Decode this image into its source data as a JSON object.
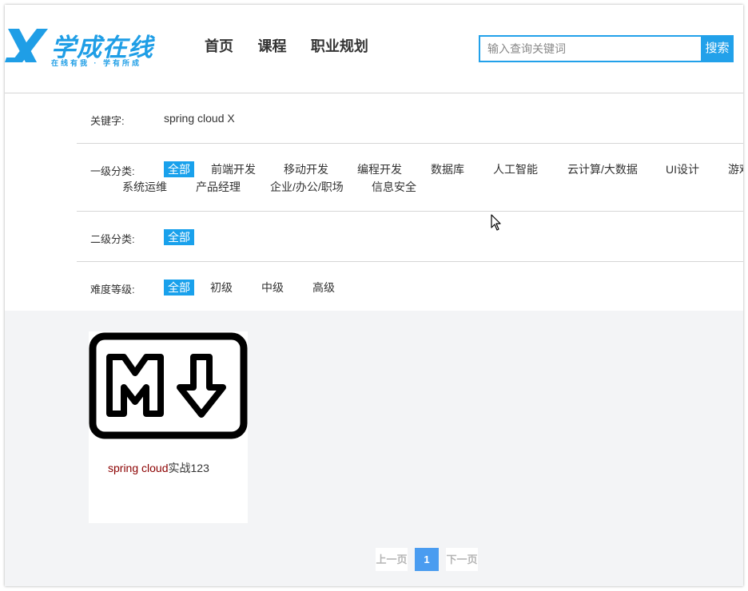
{
  "header": {
    "logo_title": "学成在线",
    "logo_slogan": "在线有我 · 学有所成",
    "nav": [
      {
        "label": "首页"
      },
      {
        "label": "课程"
      },
      {
        "label": "职业规划"
      }
    ],
    "search": {
      "value": "",
      "placeholder": "输入查询关键词",
      "button_label": "搜索"
    }
  },
  "filter": {
    "keyword_label": "关键字:",
    "keyword_value": "spring cloud",
    "keyword_clear": "X",
    "level1_label": "一级分类:",
    "level1_options": [
      "全部",
      "前端开发",
      "移动开发",
      "编程开发",
      "数据库",
      "人工智能",
      "云计算/大数据",
      "UI设计",
      "游戏",
      "系统运维",
      "产品经理",
      "企业/办公/职场",
      "信息安全"
    ],
    "level2_label": "二级分类:",
    "level2_options": [
      "全部"
    ],
    "difficulty_label": "难度等级:",
    "difficulty_options": [
      "全部",
      "初级",
      "中级",
      "高级"
    ]
  },
  "courses": [
    {
      "title_highlight": "spring cloud",
      "title_rest": "实战123",
      "icon": "markdown-icon"
    }
  ],
  "pagination": {
    "prev_label": "上一页",
    "current_page": "1",
    "next_label": "下一页"
  },
  "colors": {
    "brand": "#1f9ee6",
    "active": "#19a1ec",
    "page_active": "#4a9cf0",
    "highlight": "#8b0000",
    "content_bg": "#f3f4f6"
  }
}
